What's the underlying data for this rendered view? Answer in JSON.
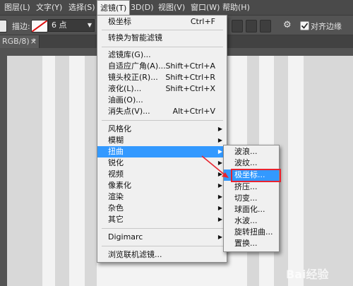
{
  "menubar": {
    "items": [
      {
        "label": "图层(L)"
      },
      {
        "label": "文字(Y)"
      },
      {
        "label": "选择(S)"
      },
      {
        "label": "滤镜(T)"
      },
      {
        "label": "3D(D)"
      },
      {
        "label": "视图(V)"
      },
      {
        "label": "窗口(W)"
      },
      {
        "label": "帮助(H)"
      }
    ]
  },
  "optbar": {
    "stroke_label": "描边:",
    "stroke_value": "6 点",
    "align_edges_label": "对齐边缘"
  },
  "doc_tab": {
    "label": "RGB/8) *"
  },
  "filter_menu": {
    "items": [
      {
        "label": "极坐标",
        "shortcut": "Ctrl+F"
      },
      {
        "label": "转换为智能滤镜"
      },
      {
        "label": "滤镜库(G)..."
      },
      {
        "label": "自适应广角(A)...",
        "shortcut": "Shift+Ctrl+A"
      },
      {
        "label": "镜头校正(R)...",
        "shortcut": "Shift+Ctrl+R"
      },
      {
        "label": "液化(L)...",
        "shortcut": "Shift+Ctrl+X"
      },
      {
        "label": "油画(O)..."
      },
      {
        "label": "消失点(V)...",
        "shortcut": "Alt+Ctrl+V"
      },
      {
        "label": "风格化"
      },
      {
        "label": "模糊"
      },
      {
        "label": "扭曲"
      },
      {
        "label": "锐化"
      },
      {
        "label": "视频"
      },
      {
        "label": "像素化"
      },
      {
        "label": "渲染"
      },
      {
        "label": "杂色"
      },
      {
        "label": "其它"
      },
      {
        "label": "Digimarc"
      },
      {
        "label": "浏览联机滤镜..."
      }
    ]
  },
  "distort_submenu": {
    "items": [
      {
        "label": "波浪..."
      },
      {
        "label": "波纹..."
      },
      {
        "label": "极坐标..."
      },
      {
        "label": "挤压..."
      },
      {
        "label": "切变..."
      },
      {
        "label": "球面化..."
      },
      {
        "label": "水波..."
      },
      {
        "label": "旋转扭曲..."
      },
      {
        "label": "置换..."
      }
    ]
  },
  "watermark": {
    "text": "Bai经验"
  },
  "colors": {
    "highlight": "#3399ff",
    "annotation": "#e8232f"
  }
}
